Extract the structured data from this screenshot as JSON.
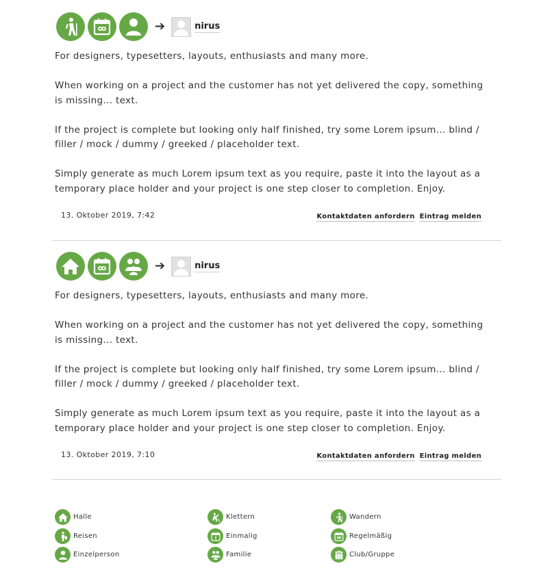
{
  "posts": [
    {
      "category_icons": [
        "hiking-icon",
        "calendar-infinity-icon",
        "single-person-icon"
      ],
      "author": "nirus",
      "paragraphs": [
        "For designers, typesetters, layouts, enthusiasts and many more.",
        "When working on a project and the customer has not yet delivered the copy, something is missing... text.",
        "If the project is complete but looking only half finished, try some Lorem ipsum... blind / filler / mock / dummy / greeked / placeholder text.",
        "Simply generate as much Lorem ipsum text as you require, paste it into the layout as a temporary place holder and your project is one step closer to completion. Enjoy."
      ],
      "date": "13. Oktober 2019, 7:42",
      "contact_link": "Kontaktdaten anfordern",
      "report_link": "Eintrag melden"
    },
    {
      "category_icons": [
        "house-icon",
        "calendar-infinity-icon",
        "family-icon"
      ],
      "author": "nirus",
      "paragraphs": [
        "For designers, typesetters, layouts, enthusiasts and many more.",
        "When working on a project and the customer has not yet delivered the copy, something is missing... text.",
        "If the project is complete but looking only half finished, try some Lorem ipsum... blind / filler / mock / dummy / greeked / placeholder text.",
        "Simply generate as much Lorem ipsum text as you require, paste it into the layout as a temporary place holder and your project is one step closer to completion. Enjoy."
      ],
      "date": "13. Oktober 2019, 7:10",
      "contact_link": "Kontaktdaten anfordern",
      "report_link": "Eintrag melden"
    }
  ],
  "legend": {
    "halle": "Halle",
    "klettern": "Klettern",
    "wandern": "Wandern",
    "reisen": "Reisen",
    "einmalig": "Einmalig",
    "regelmaessig": "Regelmäßig",
    "einzelperson": "Einzelperson",
    "familie": "Familie",
    "club": "Club/Gruppe"
  },
  "colors": {
    "accent": "#66a846",
    "text": "#333333",
    "divider": "#d6d6d6"
  }
}
